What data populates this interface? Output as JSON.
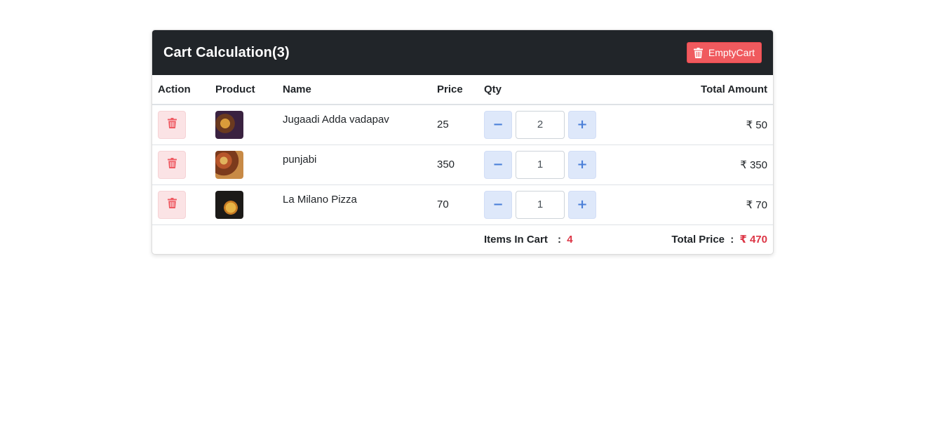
{
  "header": {
    "title": "Cart Calculation(3)",
    "empty_cart_label": "EmptyCart"
  },
  "table": {
    "columns": {
      "action": "Action",
      "product": "Product",
      "name": "Name",
      "price": "Price",
      "qty": "Qty",
      "total": "Total Amount"
    },
    "rows": [
      {
        "name": "Jugaadi Adda vadapav",
        "price": "25",
        "qty": "2",
        "total": "₹ 50"
      },
      {
        "name": "punjabi",
        "price": "350",
        "qty": "1",
        "total": "₹ 350"
      },
      {
        "name": "La Milano Pizza",
        "price": "70",
        "qty": "1",
        "total": "₹ 70"
      }
    ]
  },
  "summary": {
    "items_label": "Items In Cart",
    "separator": ":",
    "items_value": "4",
    "total_label": "Total Price",
    "total_value": "₹ 470"
  },
  "icons": {
    "delete": "trash-icon",
    "decrease": "minus-icon",
    "increase": "plus-icon",
    "minus_glyph": "−",
    "plus_glyph": "+"
  },
  "colors": {
    "header_bg": "#212529",
    "danger": "#dc3545",
    "empty_button": "#f05a5e",
    "qty_button_bg": "#dee8fa",
    "qty_button_fg": "#4a7fd8"
  }
}
